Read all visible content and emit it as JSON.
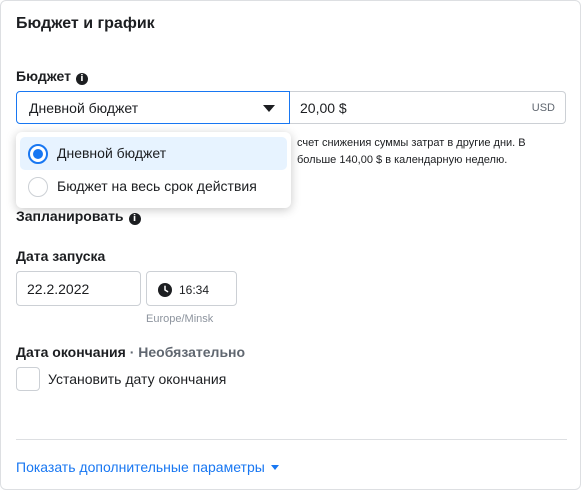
{
  "section": {
    "title": "Бюджет и график"
  },
  "budget": {
    "label": "Бюджет",
    "type_selected": "Дневной бюджет",
    "amount": "20,00 $",
    "currency": "USD",
    "helper_line1": "счет снижения суммы затрат в другие дни. В",
    "helper_line2": "больше 140,00 $ в календарную неделю.",
    "options": [
      {
        "label": "Дневной бюджет",
        "selected": true
      },
      {
        "label": "Бюджет на весь срок действия",
        "selected": false
      }
    ]
  },
  "schedule": {
    "label": "Запланировать",
    "start_label": "Дата запуска",
    "start_date": "22.2.2022",
    "start_time": "16:34",
    "timezone": "Europe/Minsk",
    "end_label": "Дата окончания",
    "end_optional": "· Необязательно",
    "end_checkbox_label": "Установить дату окончания"
  },
  "footer": {
    "more_link": "Показать дополнительные параметры"
  },
  "colors": {
    "accent": "#1877f2",
    "text": "#1c1e21",
    "muted": "#606770",
    "border": "#ccd0d5"
  }
}
